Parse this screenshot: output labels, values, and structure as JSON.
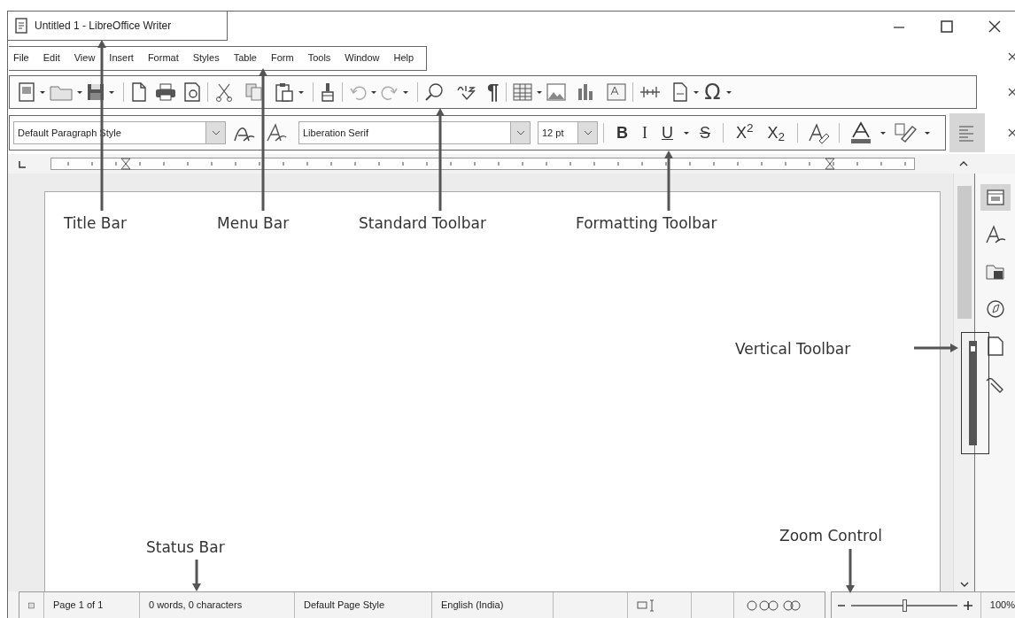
{
  "window": {
    "title": "Untitled 1 - LibreOffice Writer"
  },
  "menu_bar": {
    "items": [
      "File",
      "Edit",
      "View",
      "Insert",
      "Format",
      "Styles",
      "Table",
      "Form",
      "Tools",
      "Window",
      "Help"
    ]
  },
  "standard_toolbar": {
    "formatting_marks": "¶",
    "special_character": "Ω"
  },
  "formatting_toolbar": {
    "paragraph_style": "Default Paragraph Style",
    "font_name": "Liberation Serif",
    "font_size": "12 pt",
    "bold": "B",
    "italic": "I",
    "underline": "U",
    "strikethrough": "S",
    "superscript": "X$^{2}$",
    "subscript": "X$_{2}$",
    "align_left": {
      "selected": true
    }
  },
  "sidebar": {
    "items": [
      {
        "kind": "properties",
        "selected": true
      },
      {
        "kind": "styles",
        "selected": false
      },
      {
        "kind": "gallery",
        "selected": false
      },
      {
        "kind": "navigator",
        "selected": false
      },
      {
        "kind": "page",
        "selected": false
      },
      {
        "kind": "changes",
        "selected": false
      }
    ]
  },
  "status_bar": {
    "page": "Page 1 of 1",
    "word_count": "0 words, 0 characters",
    "page_style": "Default Page Style",
    "language": "English (India)",
    "zoom": {
      "level": 0.5,
      "reading": "100%"
    }
  },
  "annotations": [
    {
      "label": "Title Bar"
    },
    {
      "label": "Menu Bar"
    },
    {
      "label": "Standard Toolbar"
    },
    {
      "label": "Formatting Toolbar"
    },
    {
      "label": "Vertical Toolbar"
    },
    {
      "label": "Status Bar"
    },
    {
      "label": "Zoom Control"
    }
  ]
}
